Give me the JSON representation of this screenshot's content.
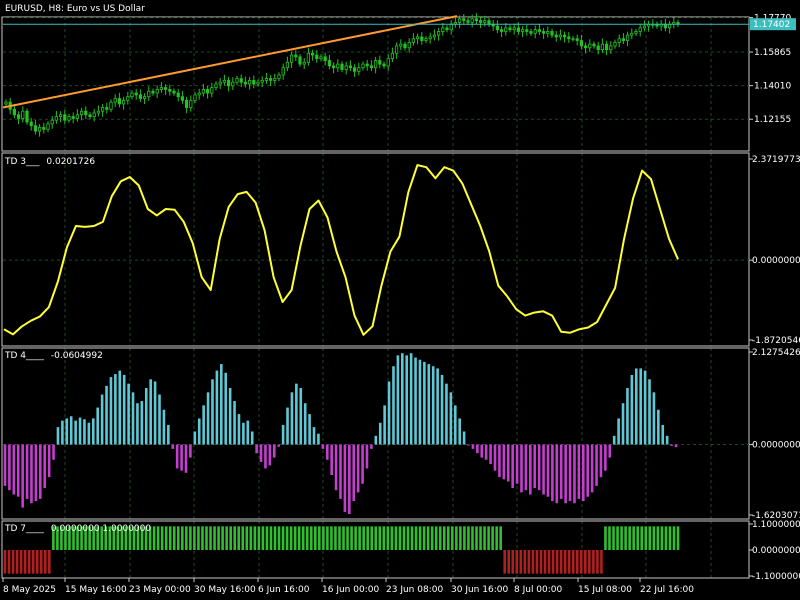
{
  "colors": {
    "background": "#000000",
    "grid": "#1f4a1f",
    "frame": "#c8c8c8",
    "candle": "#22c322",
    "trendline": "#ff9a2e",
    "bid_line": "#3dbdbd",
    "bid_badge": "#3dbdbd",
    "td3_line": "#ffff33",
    "td4_positive": "#5ec9d6",
    "td4_negative": "#c43fcf",
    "td7_positive": "#2fbf2f",
    "td7_negative": "#b02020"
  },
  "headers": {
    "price": "EURUSD, H8:  Euro vs US Dollar",
    "td3_name": "TD 3___",
    "td3_value": "0.0201726",
    "td4_name": "TD 4____",
    "td4_value": "-0.0604992",
    "td7_name": "TD 7____",
    "td7_values": "0.0000000  1.0000000"
  },
  "bid_badge": "1.17402",
  "chart_data": [
    {
      "type": "candlestick",
      "title": "EURUSD, H8:  Euro vs US Dollar",
      "symbol": "EURUSD",
      "timeframe": "H8",
      "ylim": [
        1.104,
        1.178
      ],
      "yticks": [
        "1.17770",
        "1.15865",
        "1.14010",
        "1.12155"
      ],
      "current_bid": 1.17402,
      "close": [
        1.131,
        1.127,
        1.124,
        1.122,
        1.126,
        1.12,
        1.118,
        1.115,
        1.117,
        1.116,
        1.119,
        1.121,
        1.123,
        1.124,
        1.121,
        1.123,
        1.122,
        1.124,
        1.126,
        1.124,
        1.123,
        1.125,
        1.126,
        1.128,
        1.127,
        1.131,
        1.133,
        1.13,
        1.132,
        1.134,
        1.136,
        1.135,
        1.133,
        1.134,
        1.137,
        1.136,
        1.138,
        1.139,
        1.138,
        1.137,
        1.136,
        1.134,
        1.132,
        1.128,
        1.132,
        1.135,
        1.136,
        1.138,
        1.136,
        1.139,
        1.141,
        1.142,
        1.143,
        1.14,
        1.142,
        1.144,
        1.142,
        1.141,
        1.143,
        1.141,
        1.142,
        1.143,
        1.144,
        1.143,
        1.144,
        1.146,
        1.15,
        1.153,
        1.157,
        1.156,
        1.152,
        1.153,
        1.158,
        1.157,
        1.155,
        1.156,
        1.154,
        1.151,
        1.15,
        1.152,
        1.149,
        1.151,
        1.15,
        1.148,
        1.15,
        1.152,
        1.151,
        1.15,
        1.154,
        1.152,
        1.151,
        1.155,
        1.158,
        1.162,
        1.163,
        1.161,
        1.164,
        1.166,
        1.167,
        1.165,
        1.166,
        1.167,
        1.168,
        1.17,
        1.172,
        1.171,
        1.174,
        1.175,
        1.177,
        1.176,
        1.175,
        1.177,
        1.176,
        1.175,
        1.176,
        1.174,
        1.173,
        1.171,
        1.17,
        1.172,
        1.171,
        1.172,
        1.17,
        1.171,
        1.17,
        1.169,
        1.171,
        1.17,
        1.169,
        1.17,
        1.168,
        1.167,
        1.168,
        1.167,
        1.166,
        1.166,
        1.165,
        1.162,
        1.161,
        1.163,
        1.162,
        1.16,
        1.163,
        1.16,
        1.162,
        1.164,
        1.166,
        1.165,
        1.168,
        1.169,
        1.17,
        1.172,
        1.173,
        1.174,
        1.174,
        1.173,
        1.174,
        1.172,
        1.174,
        1.175,
        1.174
      ],
      "trendline": {
        "start": {
          "time": "8 May 2025",
          "price": 1.128
        },
        "end": {
          "time": "30 Jun 16:00",
          "price": 1.1785
        }
      }
    },
    {
      "type": "line",
      "series": [
        {
          "name": "TD 3___",
          "values": [
            -1.62,
            -1.74,
            -1.55,
            -1.42,
            -1.32,
            -1.1,
            -0.5,
            0.3,
            0.8,
            0.78,
            0.8,
            0.9,
            1.5,
            1.85,
            1.95,
            1.75,
            1.2,
            1.05,
            1.2,
            1.18,
            0.9,
            0.4,
            -0.4,
            -0.7,
            0.5,
            1.25,
            1.55,
            1.6,
            1.35,
            0.7,
            -0.4,
            -0.98,
            -0.7,
            0.35,
            1.2,
            1.4,
            1.0,
            0.2,
            -0.4,
            -1.3,
            -1.75,
            -1.55,
            -0.6,
            0.2,
            0.55,
            1.6,
            2.23,
            2.18,
            1.92,
            2.18,
            2.1,
            1.8,
            1.3,
            0.8,
            0.2,
            -0.6,
            -0.85,
            -1.15,
            -1.3,
            -1.23,
            -1.2,
            -1.3,
            -1.68,
            -1.7,
            -1.62,
            -1.58,
            -1.45,
            -1.05,
            -0.65,
            0.5,
            1.45,
            2.1,
            1.9,
            1.2,
            0.5,
            0.0202
          ]
        }
      ],
      "ylim": [
        -1.8720546,
        2.3719773
      ],
      "yticks": [
        "2.3719773",
        "0.0000000",
        "-1.8720546"
      ],
      "current": "0.0201726"
    },
    {
      "type": "bar",
      "series": [
        {
          "name": "TD 4____",
          "values": [
            -0.95,
            -1.05,
            -1.15,
            -1.2,
            -1.45,
            -1.25,
            -1.35,
            -1.3,
            -1.25,
            -1.0,
            -0.75,
            -0.35,
            0.4,
            0.55,
            0.6,
            0.65,
            0.55,
            0.62,
            0.58,
            0.5,
            0.6,
            0.85,
            1.15,
            1.35,
            1.55,
            1.62,
            1.7,
            1.6,
            1.4,
            1.2,
            0.95,
            1.0,
            1.3,
            1.5,
            1.45,
            1.15,
            0.8,
            0.45,
            -0.1,
            -0.55,
            -0.6,
            -0.65,
            -0.3,
            0.3,
            0.6,
            0.9,
            1.2,
            1.5,
            1.7,
            1.85,
            1.65,
            1.3,
            1.0,
            0.7,
            0.5,
            0.55,
            0.3,
            -0.2,
            -0.4,
            -0.55,
            -0.48,
            -0.3,
            -0.05,
            0.45,
            0.85,
            1.2,
            1.4,
            1.3,
            0.95,
            0.7,
            0.4,
            0.25,
            -0.1,
            -0.35,
            -0.7,
            -1.05,
            -1.25,
            -1.55,
            -1.6,
            -1.3,
            -1.1,
            -0.9,
            -0.55,
            -0.1,
            0.2,
            0.5,
            0.9,
            1.45,
            1.8,
            2.05,
            2.1,
            2.05,
            2.1,
            2.0,
            1.95,
            1.9,
            1.85,
            1.8,
            1.75,
            1.6,
            1.4,
            1.2,
            0.9,
            0.6,
            0.3,
            -0.02,
            -0.1,
            -0.2,
            -0.3,
            -0.35,
            -0.45,
            -0.6,
            -0.75,
            -0.8,
            -0.85,
            -1.0,
            -0.9,
            -1.1,
            -1.05,
            -1.15,
            -1.0,
            -1.05,
            -1.15,
            -1.2,
            -1.3,
            -1.35,
            -1.25,
            -1.35,
            -1.3,
            -1.35,
            -1.25,
            -1.3,
            -1.2,
            -1.1,
            -0.95,
            -0.75,
            -0.6,
            -0.3,
            0.2,
            0.6,
            0.95,
            1.3,
            1.6,
            1.75,
            1.75,
            1.7,
            1.5,
            1.2,
            0.8,
            0.45,
            0.2,
            -0.03,
            -0.06
          ]
        }
      ],
      "ylim": [
        -1.6203071,
        2.1275426
      ],
      "yticks": [
        "2.1275426",
        "0.0000000",
        "-1.6203071"
      ],
      "current": "-0.0604992"
    },
    {
      "type": "bar",
      "series": [
        {
          "name": "TD 7____",
          "values": [
            -1,
            -1,
            -1,
            -1,
            -1,
            -1,
            -1,
            -1,
            -1,
            -1,
            -1,
            -1,
            -1,
            -1,
            -1,
            -1,
            -1,
            -1,
            -1,
            -1,
            -1,
            -1,
            -1,
            -1,
            -1,
            -1,
            -1,
            -1,
            -1,
            -1,
            -1,
            -1,
            -1,
            -1,
            -1,
            -1,
            -1,
            -1,
            -1,
            -1,
            -1,
            -1,
            -1,
            -1,
            -1,
            -1,
            -1,
            -1,
            -1,
            -1,
            -1,
            -1,
            -1,
            -1,
            -1,
            -1,
            -1,
            -1,
            -1,
            -1,
            -1,
            -1,
            -1,
            -1,
            -1,
            -1,
            -1,
            -1,
            -1,
            -1,
            -1,
            -1,
            -1,
            -1,
            -1,
            -1,
            -1,
            -1,
            -1,
            -1,
            -1,
            -1,
            -1,
            -1,
            -1,
            -1,
            -1,
            -1,
            -1,
            -1,
            -1,
            -1,
            -1,
            -1,
            -1,
            -1,
            -1,
            -1,
            -1,
            -1,
            -1,
            -1,
            -1,
            -1,
            -1,
            -1,
            -1,
            -1,
            -1,
            -1,
            -1,
            -1,
            -1,
            -1,
            -1,
            -1,
            -1,
            -1,
            -1,
            -1,
            -1,
            -1,
            -1,
            -1,
            -1,
            -1,
            -1,
            -1,
            -1,
            -1,
            -1,
            -1,
            -1,
            -1,
            -1,
            -1,
            -1,
            -1,
            -1,
            -1,
            -1,
            -1,
            -1,
            -1,
            -1,
            -1,
            -1,
            -1,
            -1,
            -1,
            -1,
            -1,
            -1,
            -1,
            -1,
            -1,
            -1,
            -1,
            -1,
            -1,
            -1,
            -1,
            -1,
            -1,
            -1,
            -1,
            -1,
            -1
          ]
        }
      ],
      "segments": [
        {
          "from": "8 May 2025",
          "to": "15 May 16:00",
          "value": -1
        },
        {
          "from": "15 May 16:00",
          "to": "8 Jul 00:00",
          "value": 1
        },
        {
          "from": "8 Jul 00:00",
          "to": "15 Jul 08:00",
          "value": -1
        },
        {
          "from": "15 Jul 08:00",
          "to": "22 Jul 16:00",
          "value": 1
        }
      ],
      "ylim": [
        -1.1,
        1.1
      ],
      "yticks": [
        "1.1000000",
        "0.0000000",
        "-1.1000000"
      ]
    }
  ],
  "time_axis": [
    "8 May 2025",
    "15 May 16:00",
    "23 May 00:00",
    "30 May 16:00",
    "6 Jun 16:00",
    "16 Jun 00:00",
    "23 Jun 08:00",
    "30 Jun 16:00",
    "8 Jul 00:00",
    "15 Jul 08:00",
    "22 Jul 16:00"
  ]
}
